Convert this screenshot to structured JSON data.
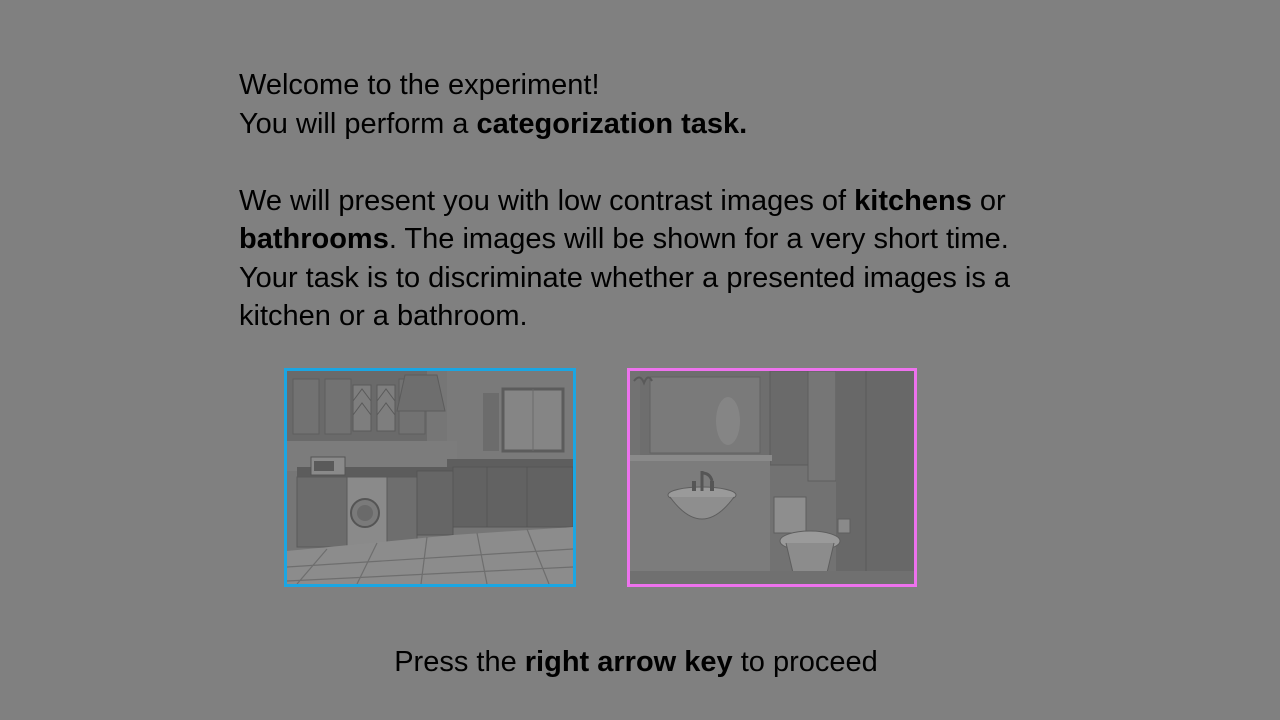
{
  "instructions": {
    "line1": "Welcome to the experiment!",
    "line2_pre": "You will perform a ",
    "line2_bold": "categorization task.",
    "para_pre": "We will present you with low contrast images of ",
    "para_bold1": "kitchens",
    "para_mid1": " or ",
    "para_bold2": "bathrooms",
    "para_rest": ". The images will be shown for a very short time. Your task is to discriminate whether a presented images is a kitchen or a bathroom."
  },
  "examples": {
    "kitchen_icon": "kitchen-example-image",
    "bathroom_icon": "bathroom-example-image",
    "kitchen_border_color": "#1aa6e3",
    "bathroom_border_color": "#ee72ee"
  },
  "footer": {
    "pre": "Press the ",
    "bold": "right arrow key",
    "post": " to proceed"
  }
}
